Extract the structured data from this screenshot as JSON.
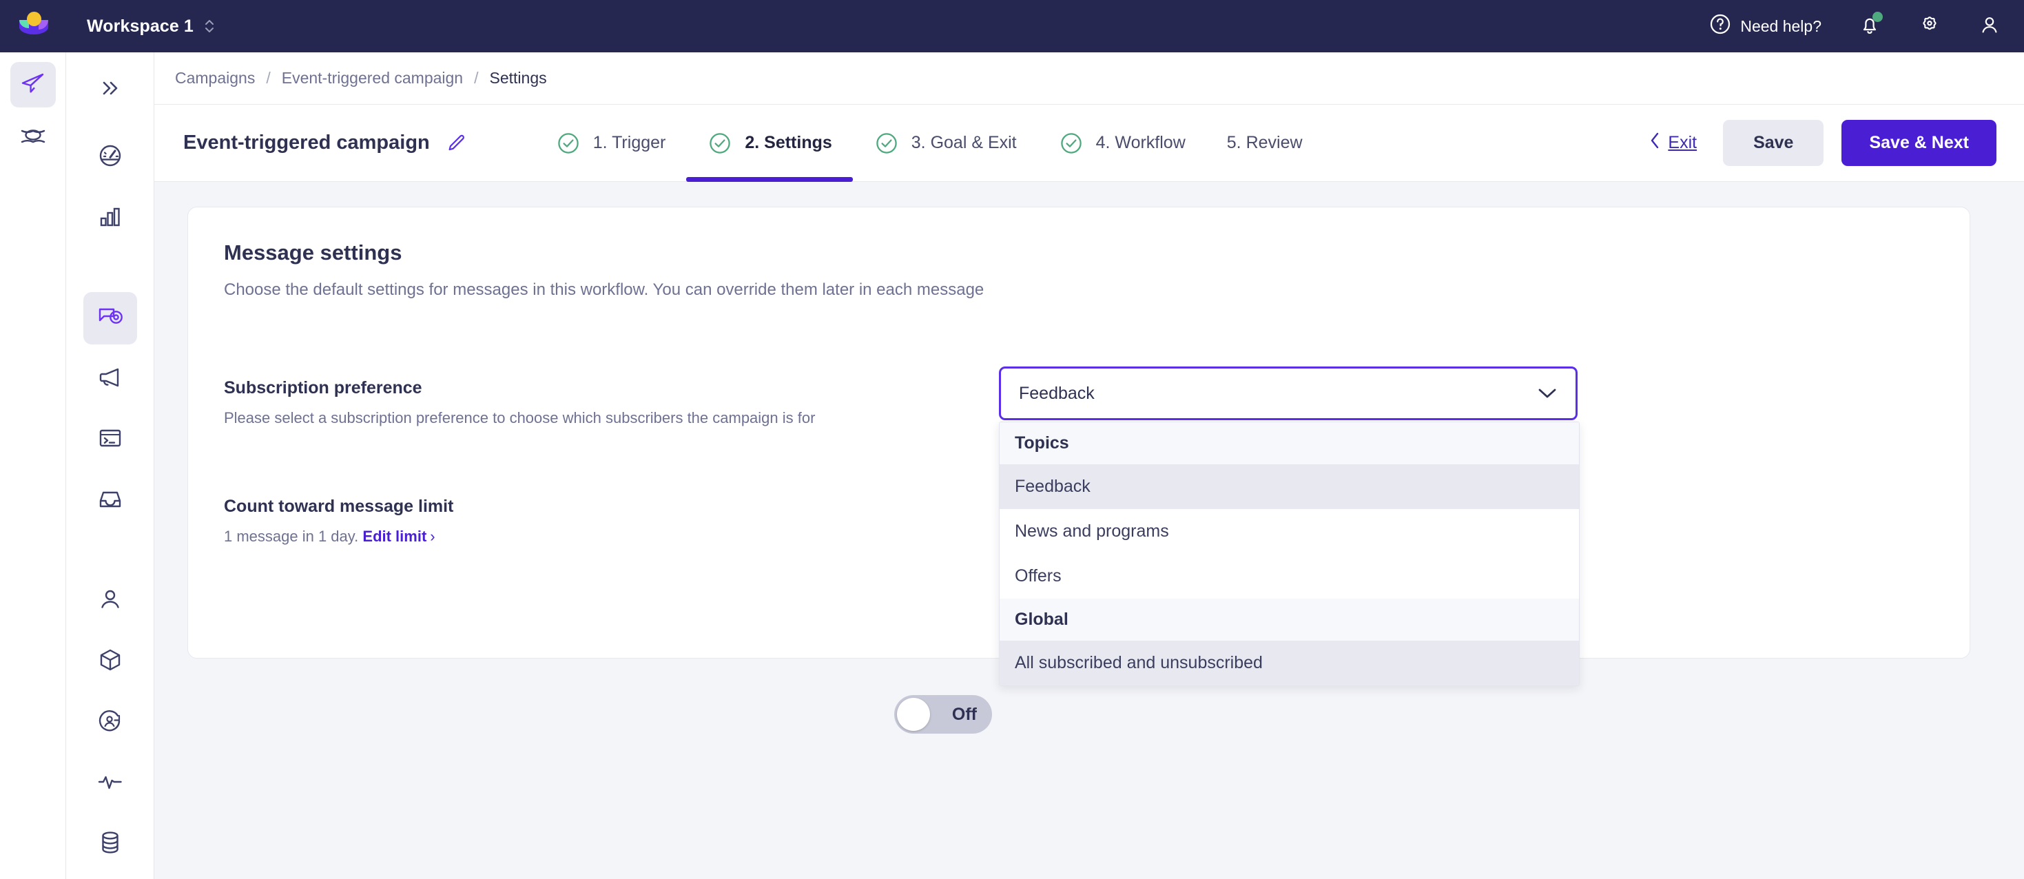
{
  "topbar": {
    "workspace_label": "Workspace 1",
    "need_help_label": "Need help?",
    "logo_colors": {
      "dot": "#f4c430",
      "left": "#5fe0b0",
      "right": "#a45ff3",
      "bowl": "#5b2fe8"
    },
    "bar_color": "#252750",
    "notification_dot_color": "#4fa97e",
    "icons": [
      "help-circle-icon",
      "bell-icon",
      "gear-icon",
      "user-icon"
    ]
  },
  "rail": {
    "items": [
      {
        "icon": "paper-plane-icon",
        "active": true
      },
      {
        "icon": "layers-stack-icon",
        "active": false
      }
    ]
  },
  "nav": {
    "collapse_icon": "double-chevron-right-icon",
    "items": [
      {
        "icon": "speedometer-icon",
        "active": false
      },
      {
        "icon": "bar-chart-icon",
        "active": false
      },
      {
        "icon": "campaign-target-icon",
        "active": true
      },
      {
        "icon": "megaphone-icon",
        "active": false
      },
      {
        "icon": "terminal-icon",
        "active": false
      },
      {
        "icon": "inbox-icon",
        "active": false
      },
      {
        "icon": "person-icon",
        "active": false
      },
      {
        "icon": "cube-icon",
        "active": false
      },
      {
        "icon": "audience-icon",
        "active": false
      },
      {
        "icon": "pulse-icon",
        "active": false
      },
      {
        "icon": "database-icon",
        "active": false
      }
    ]
  },
  "breadcrumb": {
    "items": [
      "Campaigns",
      "Event-triggered campaign",
      "Settings"
    ],
    "separator": "/"
  },
  "header": {
    "campaign_name": "Event-triggered campaign",
    "edit_icon": "pencil-icon",
    "steps": [
      {
        "label": "1. Trigger",
        "complete": true,
        "active": false
      },
      {
        "label": "2. Settings",
        "complete": true,
        "active": true
      },
      {
        "label": "3. Goal & Exit",
        "complete": true,
        "active": false
      },
      {
        "label": "4. Workflow",
        "complete": true,
        "active": false
      },
      {
        "label": "5. Review",
        "complete": false,
        "active": false
      }
    ],
    "exit_label": "Exit",
    "save_label": "Save",
    "save_next_label": "Save & Next",
    "accent_color": "#4a1fd4",
    "check_color": "#4fa97e"
  },
  "card": {
    "title": "Message settings",
    "subtitle": "Choose the default settings for messages in this workflow. You can override them later in each message",
    "subscription": {
      "label": "Subscription preference",
      "description": "Please select a subscription preference to choose which subscribers the campaign is for",
      "selected_value": "Feedback",
      "caret_icon": "chevron-down-icon",
      "open": true,
      "groups": [
        {
          "group_label": "Topics",
          "options": [
            "Feedback",
            "News and programs",
            "Offers"
          ]
        },
        {
          "group_label": "Global",
          "options": [
            "All subscribed and unsubscribed"
          ]
        }
      ],
      "highlighted_options": [
        "Feedback",
        "All subscribed and unsubscribed"
      ]
    },
    "message_limit": {
      "label": "Count toward message limit",
      "toggle_state": "Off",
      "toggle_on": false,
      "limit_text": "1 message in 1 day.",
      "edit_link_label": "Edit limit",
      "edit_link_chevron": "chevron-right-icon"
    }
  }
}
